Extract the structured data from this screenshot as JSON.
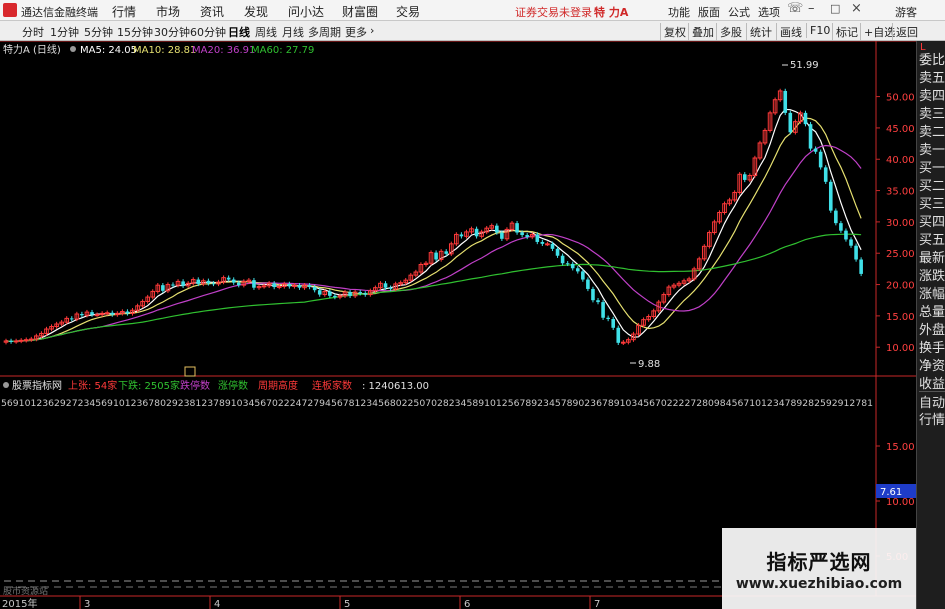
{
  "menubar": {
    "app_name": "通达信金融终端",
    "items": [
      "行情",
      "市场",
      "资讯",
      "发现",
      "问小达",
      "财富圈",
      "交易"
    ],
    "login_warning": "证券交易未登录",
    "stock_title": "特 力A",
    "right_items": [
      "功能",
      "版面",
      "公式",
      "选项"
    ],
    "guest": "游客"
  },
  "toolbar": {
    "periods": [
      "分时",
      "1分钟",
      "5分钟",
      "15分钟",
      "30分钟",
      "60分钟",
      "日线",
      "周线",
      "月线",
      "多周期",
      "更多"
    ],
    "active_period": "日线",
    "right_items": [
      "复权",
      "叠加",
      "多股",
      "统计",
      "画线",
      "F10",
      "标记",
      "+自选",
      "返回"
    ]
  },
  "main_panel": {
    "stock_label": "特力A (日线)",
    "ma5_label": "MA5: 24.05",
    "ma10_label": "MA10: 28.81",
    "ma20_label": "MA20: 36.91",
    "ma60_label": "MA60: 27.79",
    "high_label": "51.99",
    "low_label": "9.88"
  },
  "sub_panel": {
    "indicator_name": "股票指标网",
    "up_count": "上张: 54家",
    "down_count": "下跌: 2505家",
    "limit_down": "跌停数",
    "limit_up": "涨停数",
    "cycle_high": "周期高度",
    "board_count": "连板家数",
    "value": ": 1240613.00",
    "digit_row": "5691012362927234569101236780292381237891034567022247279456781234568022507028234589101256789234578902367891034567022227280984567101234789282592912781",
    "current_value": "7.61",
    "bottom_tag": "股市资源站"
  },
  "date_axis": {
    "labels": [
      "2015年",
      "3",
      "4",
      "5",
      "6",
      "7"
    ]
  },
  "side_panel": {
    "top_label": "L",
    "items": [
      "委比",
      "卖五",
      "卖四",
      "卖三",
      "卖二",
      "卖一",
      "买一",
      "买二",
      "买三",
      "买四",
      "买五",
      "最新",
      "涨跌",
      "涨幅",
      "总量",
      "外盘",
      "换手",
      "净资",
      "收益",
      "自动",
      "行情"
    ]
  },
  "watermark": {
    "line1": "指标严选网",
    "line2": "www.xuezhibiao.com"
  },
  "colors": {
    "up": "#ff3a3a",
    "down": "#40e0e8",
    "ma5": "#ffffff",
    "ma10": "#e6e070",
    "ma20": "#c040c8",
    "ma60": "#30c030",
    "axis": "#c82828"
  },
  "chart_data": {
    "type": "candlestick",
    "y_axis_ticks": [
      10,
      15,
      20,
      25,
      30,
      35,
      40,
      45,
      50
    ],
    "y_axis_labels": [
      "10.00",
      "15.00",
      "20.00",
      "25.00",
      "30.00",
      "35.00",
      "40.00",
      "45.00",
      "50.00"
    ],
    "ylim": [
      7,
      56
    ],
    "sub_axis_ticks": [
      15,
      10,
      5
    ],
    "sub_axis_labels": [
      "15.00",
      "10.00",
      "5.00"
    ],
    "sub_ylim": [
      2,
      18
    ],
    "closes": [
      11.0,
      10.9,
      11.0,
      11.1,
      11.2,
      11.3,
      11.8,
      12.2,
      12.9,
      13.3,
      13.7,
      14.0,
      14.6,
      14.5,
      15.3,
      15.1,
      15.6,
      15.2,
      15.2,
      15.4,
      15.5,
      15.2,
      15.4,
      15.7,
      15.4,
      15.9,
      16.6,
      17.3,
      18.0,
      18.9,
      19.9,
      19.0,
      20.0,
      19.9,
      20.5,
      19.8,
      20.2,
      20.8,
      20.1,
      20.6,
      20.2,
      20.1,
      20.4,
      21.1,
      20.8,
      20.3,
      19.9,
      20.5,
      20.7,
      19.5,
      19.7,
      19.8,
      20.2,
      19.6,
      19.7,
      20.1,
      19.7,
      19.9,
      19.5,
      19.9,
      19.6,
      19.1,
      18.4,
      18.9,
      18.2,
      18.0,
      18.2,
      18.8,
      18.2,
      18.8,
      18.6,
      18.4,
      19.0,
      19.5,
      20.2,
      19.5,
      19.3,
      20.1,
      20.3,
      20.7,
      21.5,
      22.0,
      23.2,
      23.4,
      25.1,
      24.0,
      25.3,
      24.9,
      26.5,
      28.0,
      27.7,
      28.4,
      28.9,
      27.7,
      28.4,
      29.0,
      29.4,
      28.3,
      27.3,
      28.8,
      29.8,
      28.3,
      27.9,
      27.6,
      28.0,
      26.8,
      26.5,
      26.5,
      25.7,
      24.6,
      23.4,
      23.3,
      22.6,
      22.1,
      20.8,
      19.3,
      17.5,
      17.2,
      14.7,
      14.5,
      13.1,
      10.7,
      10.8,
      11.2,
      12.1,
      13.5,
      14.4,
      14.9,
      15.8,
      17.2,
      18.4,
      19.6,
      19.9,
      20.2,
      20.6,
      20.9,
      22.5,
      24.1,
      26.1,
      28.3,
      30.0,
      31.5,
      32.9,
      33.5,
      34.7,
      37.6,
      36.7,
      37.4,
      40.2,
      42.6,
      44.6,
      47.4,
      49.5,
      50.9,
      47.4,
      44.3,
      46.0,
      47.4,
      45.6,
      41.7,
      41.2,
      38.7,
      36.4,
      31.8,
      29.8,
      28.6,
      27.2,
      26.2,
      24.0,
      21.7
    ]
  }
}
